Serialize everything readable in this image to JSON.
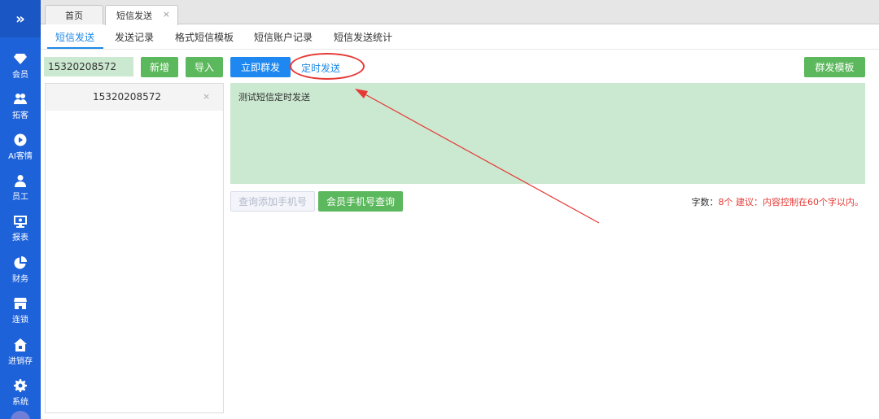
{
  "sidebar": {
    "toggle_glyph": "»",
    "items": [
      {
        "label": "会员",
        "icon": "diamond-icon"
      },
      {
        "label": "拓客",
        "icon": "users-icon"
      },
      {
        "label": "AI客情",
        "icon": "play-circle-icon"
      },
      {
        "label": "员工",
        "icon": "user-icon"
      },
      {
        "label": "报表",
        "icon": "monitor-icon"
      },
      {
        "label": "财务",
        "icon": "pie-chart-icon"
      },
      {
        "label": "连锁",
        "icon": "store-icon"
      },
      {
        "label": "进销存",
        "icon": "home-icon"
      },
      {
        "label": "系统",
        "icon": "gear-icon"
      }
    ]
  },
  "page_tabs": [
    {
      "label": "首页"
    },
    {
      "label": "短信发送",
      "close": "×"
    }
  ],
  "sub_tabs": [
    "短信发送",
    "发送记录",
    "格式短信模板",
    "短信账户记录",
    "短信发送统计"
  ],
  "toolbar": {
    "phone_value": "15320208572",
    "add_label": "新增",
    "import_label": "导入",
    "send_now_label": "立即群发",
    "scheduled_label": "定时发送",
    "template_label": "群发模板"
  },
  "phone_list": [
    {
      "number": "15320208572",
      "remove": "×"
    }
  ],
  "message": {
    "content": "测试短信定时发送"
  },
  "actions": {
    "query_add_label": "查询添加手机号",
    "member_query_label": "会员手机号查询"
  },
  "counter": {
    "label": "字数：",
    "count": "8个",
    "advice_label": "建议：",
    "advice_text": "内容控制在60个字以内。"
  },
  "colors": {
    "sidebar": "#1e62d9",
    "green": "#5cb85c",
    "blue": "#1e88f0",
    "annotation_red": "#e53935",
    "light_green_field": "#cbe8d0"
  }
}
